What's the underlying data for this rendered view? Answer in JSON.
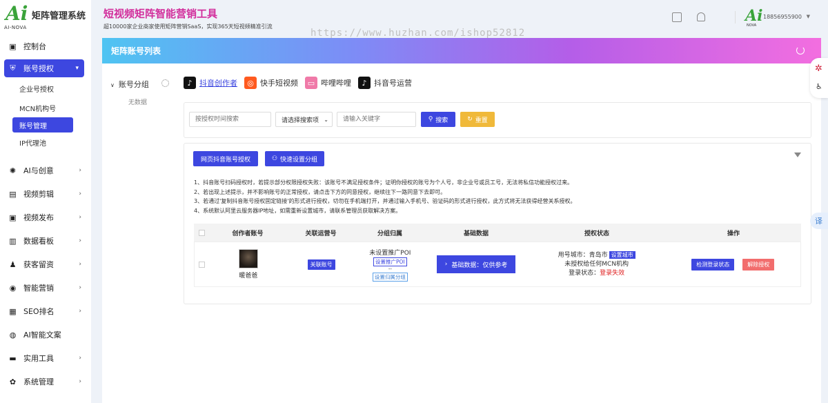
{
  "brand": {
    "logo_letters": "Ai",
    "logo_name": "AI-NOVA",
    "title": "矩阵管理系统"
  },
  "sidebar": {
    "items": [
      {
        "label": "控制台",
        "icon": "monitor-icon"
      },
      {
        "label": "账号授权",
        "icon": "shield-icon",
        "active": true
      },
      {
        "label": "AI与创意",
        "icon": "bulb-icon"
      },
      {
        "label": "视频剪辑",
        "icon": "film-icon"
      },
      {
        "label": "视频发布",
        "icon": "upload-icon"
      },
      {
        "label": "数据看板",
        "icon": "chart-icon"
      },
      {
        "label": "获客留资",
        "icon": "user-icon"
      },
      {
        "label": "智能营销",
        "icon": "target-icon"
      },
      {
        "label": "SEO排名",
        "icon": "ranking-icon"
      },
      {
        "label": "AI智能文案",
        "icon": "ai-icon"
      },
      {
        "label": "实用工具",
        "icon": "toolbox-icon"
      },
      {
        "label": "系统管理",
        "icon": "gear-icon"
      }
    ],
    "sub_items": [
      {
        "label": "企业号授权"
      },
      {
        "label": "MCN机构号"
      },
      {
        "label": "账号管理",
        "active": true
      },
      {
        "label": "IP代理池"
      }
    ]
  },
  "header": {
    "title": "短视频矩阵智能营销工具",
    "subtitle": "超10000家企业商家使用矩阵营销SaaS，实现365天短视频精准引流",
    "watermark": "https://www.huzhan.com/ishop52812",
    "user": "18856955900",
    "avatar_letters": "Ai",
    "avatar_name": "NOVA"
  },
  "page": {
    "banner_title": "矩阵账号列表",
    "group_title": "账号分组",
    "no_data": "无数据",
    "platforms": [
      {
        "label": "抖音创作者",
        "icon": "tiktok-icon",
        "color": "#111111",
        "active": true
      },
      {
        "label": "快手短视频",
        "icon": "kuaishou-icon",
        "color": "#ff5a1f"
      },
      {
        "label": "哔哩哔哩",
        "icon": "bilibili-icon",
        "color": "#f07aa8"
      },
      {
        "label": "抖音号运营",
        "icon": "tiktok-icon",
        "color": "#111111"
      }
    ],
    "search": {
      "time_placeholder": "按授权时间搜索",
      "select_value": "请选择搜索项",
      "keyword_placeholder": "请输入关键字",
      "search_btn": "搜索",
      "reset_btn": "重置"
    },
    "actions": {
      "web_auth": "网页抖音账号授权",
      "quick_group": "快速设置分组"
    },
    "notes": [
      "1、抖音账号扫码授权时，若提示部分权限授权失败：该账号不满足授权条件；证明你授权的账号为个人号，非企业号或员工号，无法将私信功能授权过来。",
      "2、若出现上述提示，并不影响账号的正常授权，请点击下方的同意授权，继续往下一路同意下去即可。",
      "3、若通过'复制抖音账号授权固定链接'的形式进行授权，切勿在手机端打开，并通过输入手机号、验证码的形式进行授权，此方式将无法获得经营关系授权。",
      "4、系统默认阿里云服务器IP地址，如需重新设置城市，请联系管理员获取解决方案。"
    ],
    "table": {
      "headers": [
        "创作者账号",
        "关联运营号",
        "分组归属",
        "基础数据",
        "授权状态",
        "操作"
      ],
      "row": {
        "name": "暖爸爸",
        "link_btn": "关联账号",
        "poi_text": "未设置推广POI",
        "poi_btn": "设置推广POI",
        "dash": "--",
        "group_btn": "设置归属分组",
        "basic_btn": "基础数据：仅供参考",
        "city_label": "用号城市：青岛市",
        "city_btn": "设置城市",
        "mcn": "未授权给任何MCN机构",
        "login_label": "登录状态：",
        "login_value": "登录失效",
        "check_btn": "检测登录状态",
        "revoke_btn": "解除授权"
      }
    }
  },
  "float": {
    "translate": "译"
  }
}
